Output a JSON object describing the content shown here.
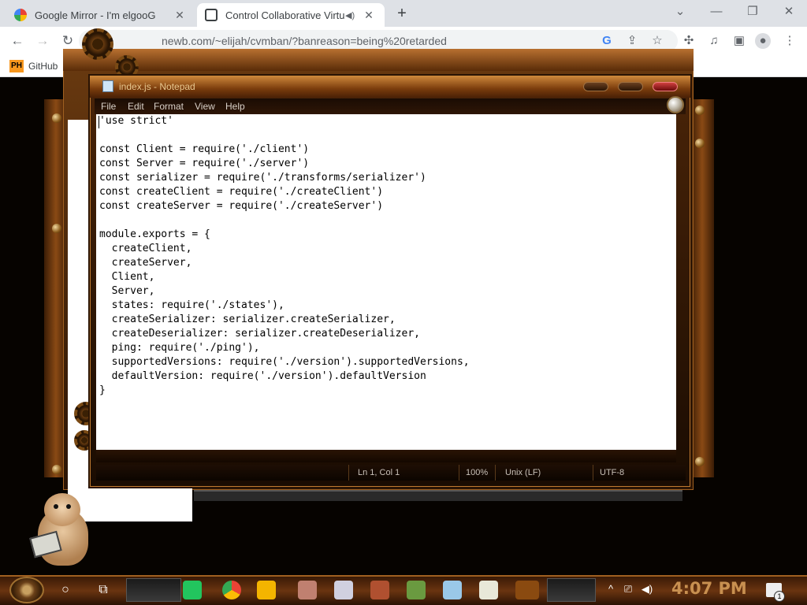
{
  "browser": {
    "tabs": [
      {
        "title": "Google Mirror - I'm elgooG",
        "active": false
      },
      {
        "title": "Control Collaborative Virtual",
        "active": true
      }
    ],
    "new_tab": "+",
    "url": "newb.com/~elijah/cvmban/?banreason=being%20retarded",
    "bookmarks": [
      {
        "label": "GitHub",
        "badge": "PH"
      }
    ],
    "window_controls": {
      "minimize": "—",
      "restore": "❐",
      "close": "✕"
    }
  },
  "notepad": {
    "title": "index.js - Notepad",
    "menu": [
      "File",
      "Edit",
      "Format",
      "View",
      "Help"
    ],
    "code": [
      "'use strict'",
      "",
      "const Client = require('./client')",
      "const Server = require('./server')",
      "const serializer = require('./transforms/serializer')",
      "const createClient = require('./createClient')",
      "const createServer = require('./createServer')",
      "",
      "module.exports = {",
      "  createClient,",
      "  createServer,",
      "  Client,",
      "  Server,",
      "  states: require('./states'),",
      "  createSerializer: serializer.createSerializer,",
      "  createDeserializer: serializer.createDeserializer,",
      "  ping: require('./ping'),",
      "  supportedVersions: require('./version').supportedVersions,",
      "  defaultVersion: require('./version').defaultVersion",
      "}"
    ],
    "status": {
      "position": "Ln 1, Col 1",
      "zoom": "100%",
      "line_endings": "Unix (LF)",
      "encoding": "UTF-8"
    }
  },
  "taskbar": {
    "clock": "4:07 PM",
    "notification_count": "1"
  }
}
